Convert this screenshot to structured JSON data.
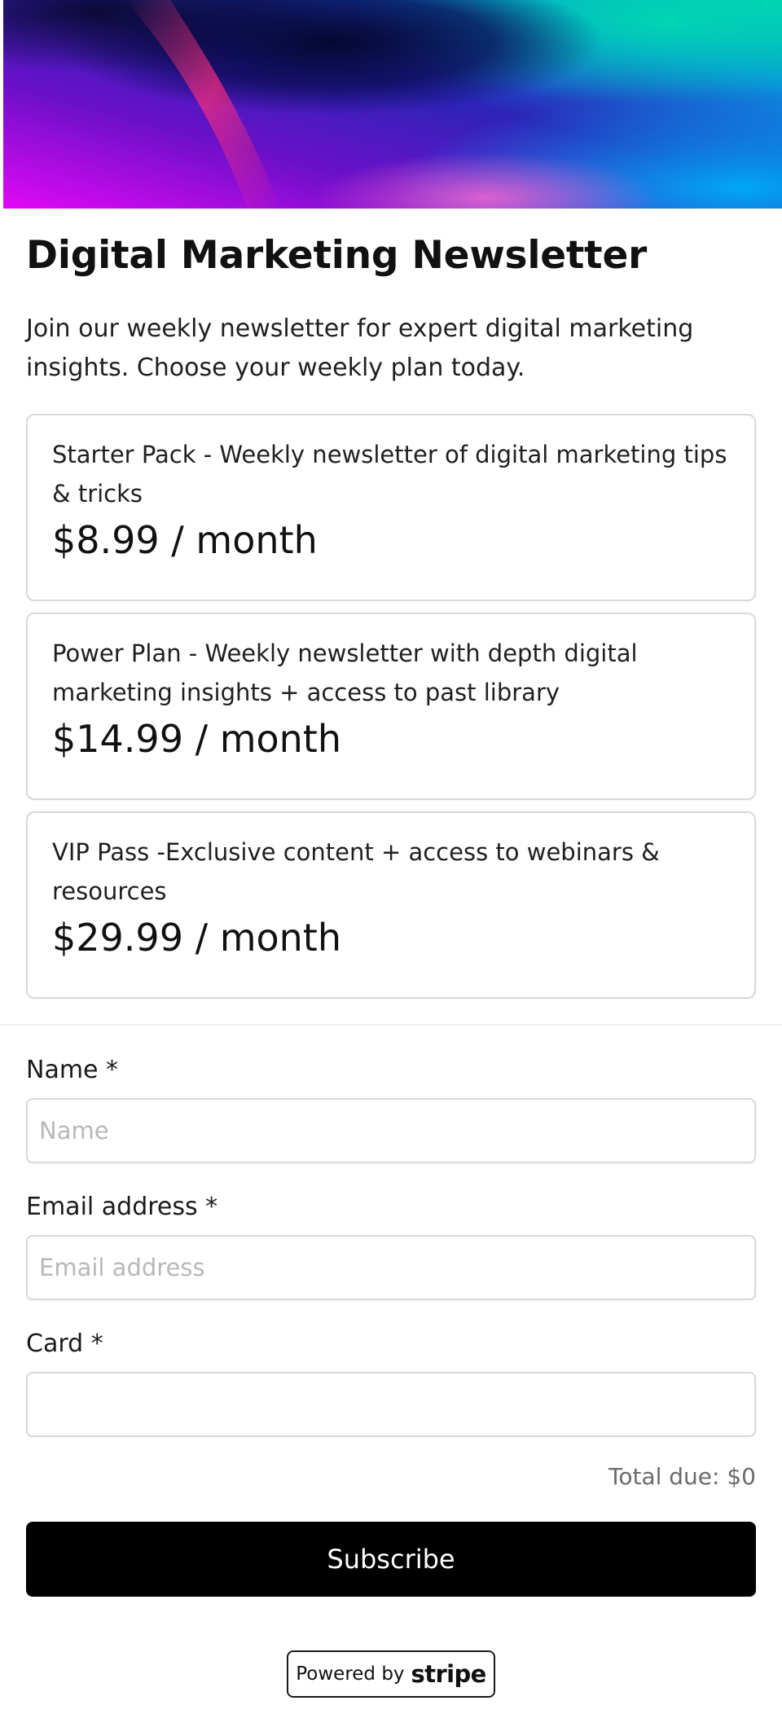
{
  "header": {
    "title": "Digital Marketing Newsletter",
    "description": "Join our weekly newsletter for expert digital marketing insights. Choose your weekly plan today."
  },
  "plans": [
    {
      "description": "Starter Pack - Weekly newsletter of digital marketing tips & tricks",
      "price": "$8.99 / month"
    },
    {
      "description": "Power Plan - Weekly newsletter with depth digital marketing insights + access to past library",
      "price": "$14.99 / month"
    },
    {
      "description": "VIP Pass -Exclusive content + access to webinars & resources",
      "price": "$29.99 / month"
    }
  ],
  "form": {
    "name": {
      "label": "Name *",
      "placeholder": "Name",
      "value": ""
    },
    "email": {
      "label": "Email address *",
      "placeholder": "Email address",
      "value": ""
    },
    "card": {
      "label": "Card *",
      "value": ""
    }
  },
  "total_due": "Total due: $0",
  "subscribe_label": "Subscribe",
  "powered_by": {
    "prefix": "Powered by",
    "brand": "stripe"
  }
}
